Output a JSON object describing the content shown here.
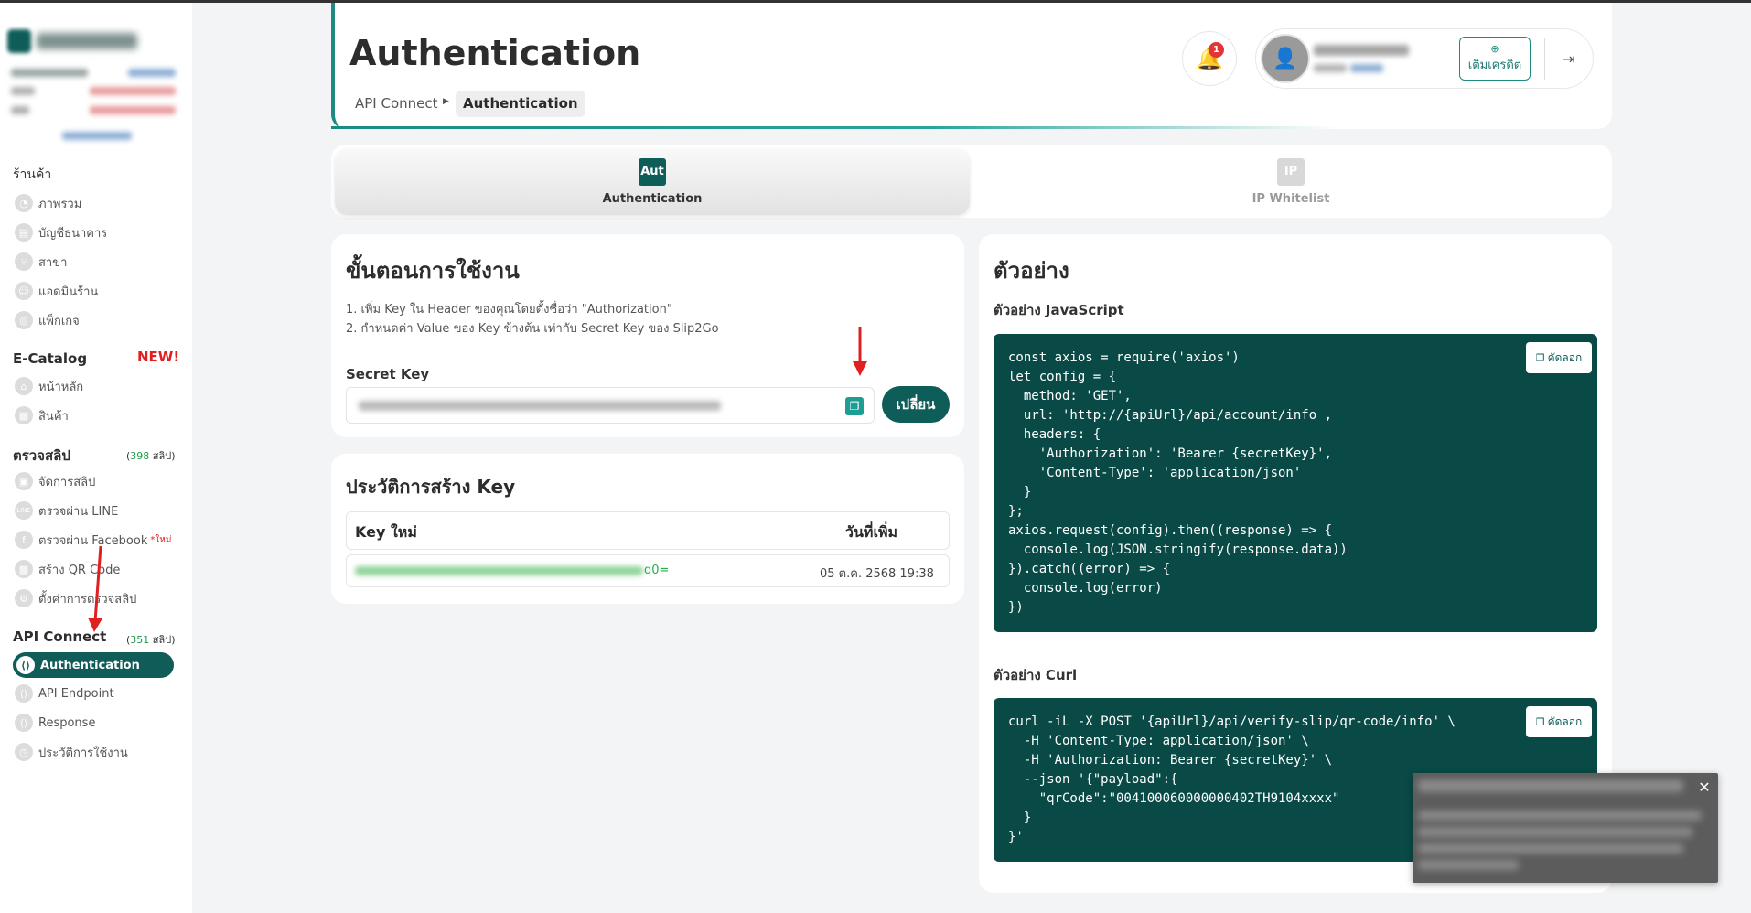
{
  "sidebar": {
    "shop_label": "ร้านค้า",
    "shop_items": [
      {
        "label": "ภาพรวม",
        "icon": "dashboard-icon"
      },
      {
        "label": "บัญชีธนาคาร",
        "icon": "bank-icon"
      },
      {
        "label": "สาขา",
        "icon": "branch-icon"
      },
      {
        "label": "แอดมินร้าน",
        "icon": "admin-icon"
      },
      {
        "label": "แพ็กเกจ",
        "icon": "package-icon"
      }
    ],
    "ecatalog": {
      "label": "E-Catalog",
      "badge": "NEW!",
      "items": [
        {
          "label": "หน้าหลัก",
          "icon": "home-icon"
        },
        {
          "label": "สินค้า",
          "icon": "product-icon"
        }
      ]
    },
    "verify": {
      "label": "ตรวจสลิป",
      "count_prefix": "(",
      "count": "398",
      "count_suffix": " สลิป)",
      "items": [
        {
          "label": "จัดการสลิป",
          "icon": "slip-icon"
        },
        {
          "label": "ตรวจผ่าน LINE",
          "icon": "line-icon"
        },
        {
          "label": "ตรวจผ่าน Facebook",
          "icon": "facebook-icon",
          "new": "*ใหม่"
        },
        {
          "label": "สร้าง QR Code",
          "icon": "qr-icon"
        },
        {
          "label": "ตั้งค่าการตรวจสลิป",
          "icon": "settings-icon"
        }
      ]
    },
    "api": {
      "label": "API Connect",
      "count_prefix": "(",
      "count": "351",
      "count_suffix": " สลิป)",
      "items": [
        {
          "label": "Authentication",
          "icon": "auth-icon",
          "active": true
        },
        {
          "label": "API Endpoint",
          "icon": "endpoint-icon"
        },
        {
          "label": "Response",
          "icon": "response-icon"
        },
        {
          "label": "ประวัติการใช้งาน",
          "icon": "history-icon"
        }
      ]
    }
  },
  "header": {
    "title": "Authentication",
    "breadcrumb": [
      "API Connect",
      "Authentication"
    ],
    "notification_count": "1",
    "topup_label": "เติมเครดิต"
  },
  "tabs": [
    {
      "icon_text": "Aut",
      "label": "Authentication"
    },
    {
      "icon_text": "IP",
      "label": "IP Whitelist"
    }
  ],
  "steps_card": {
    "title": "ขั้นตอนการใช้งาน",
    "steps": [
      "1. เพิ่ม Key ใน Header ของคุณโดยตั้งชื่อว่า \"Authorization\"",
      "2. กำหนดค่า Value ของ Key ข้างต้น เท่ากับ Secret Key ของ Slip2Go"
    ],
    "secret_key_label": "Secret Key",
    "change_button": "เปลี่ยน"
  },
  "history_card": {
    "title": "ประวัติการสร้าง Key",
    "columns": [
      "Key ใหม่",
      "วันที่เพิ่ม"
    ],
    "rows": [
      {
        "key_tail": "q0=",
        "date": "05 ต.ค. 2568 19:38"
      }
    ]
  },
  "example_card": {
    "title": "ตัวอย่าง",
    "js_label": "ตัวอย่าง JavaScript",
    "js_code": "const axios = require('axios')\nlet config = {\n  method: 'GET',\n  url: 'http://{apiUrl}/api/account/info ,\n  headers: {\n    'Authorization': 'Bearer {secretKey}',\n    'Content-Type': 'application/json'\n  }\n};\naxios.request(config).then((response) => {\n  console.log(JSON.stringify(response.data))\n}).catch((error) => {\n  console.log(error)\n})",
    "curl_label": "ตัวอย่าง Curl",
    "curl_code": "curl -iL -X POST '{apiUrl}/api/verify-slip/qr-code/info' \\\n  -H 'Content-Type: application/json' \\\n  -H 'Authorization: Bearer {secretKey}' \\\n  --json '{\"payload\":{\n    \"qrCode\":\"004100060000000402TH9104xxxx\"\n  }\n}'",
    "copy_label": "คัดลอก"
  },
  "colors": {
    "primary": "#0f5d59",
    "accent": "#1e8a80",
    "danger": "#e23636",
    "success": "#1fb34a"
  }
}
